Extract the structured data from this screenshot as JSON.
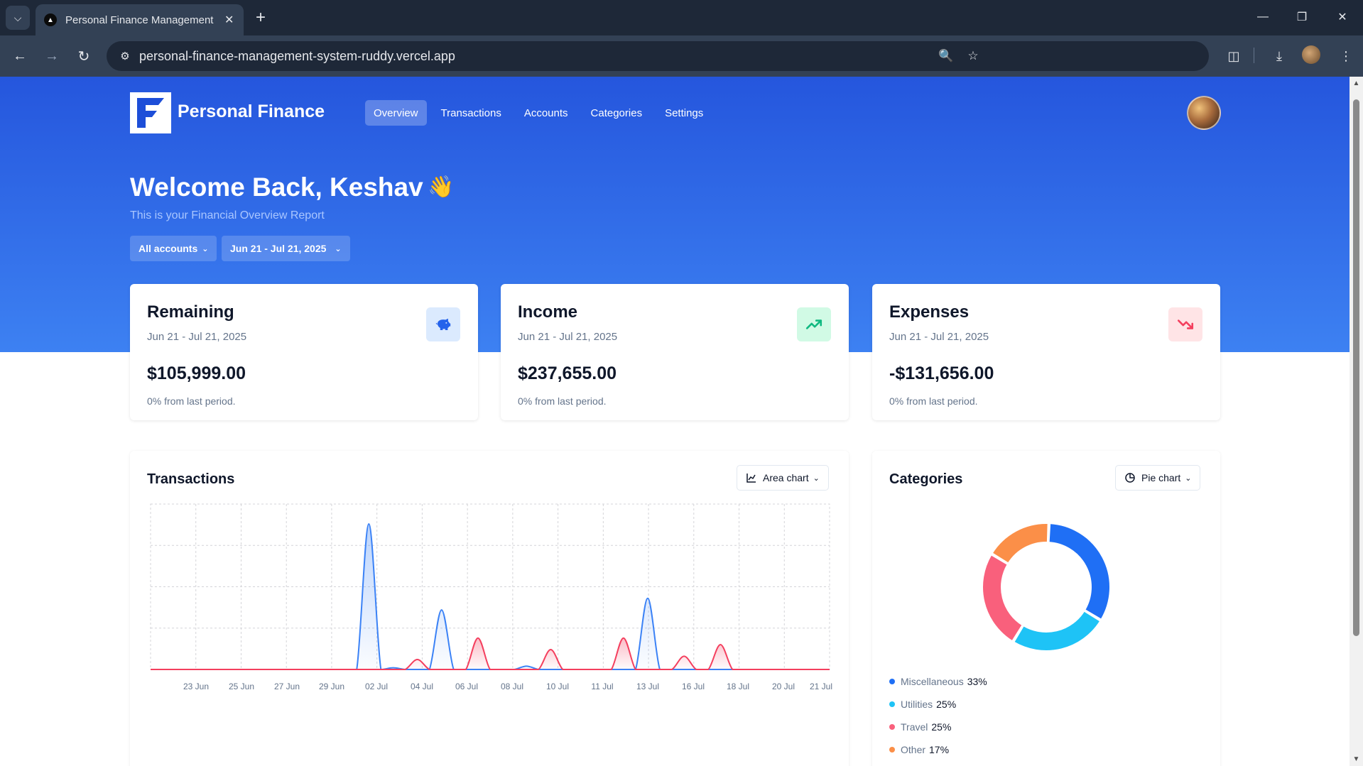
{
  "browser": {
    "tab_title": "Personal Finance Management",
    "url": "personal-finance-management-system-ruddy.vercel.app"
  },
  "header": {
    "brand": "Personal Finance",
    "nav": [
      {
        "label": "Overview",
        "active": true
      },
      {
        "label": "Transactions",
        "active": false
      },
      {
        "label": "Accounts",
        "active": false
      },
      {
        "label": "Categories",
        "active": false
      },
      {
        "label": "Settings",
        "active": false
      }
    ]
  },
  "hero": {
    "welcome": "Welcome Back, Keshav",
    "wave": "👋",
    "subtitle": "This is your Financial Overview Report",
    "account_filter": "All accounts",
    "date_filter": "Jun 21 - Jul 21, 2025"
  },
  "cards": [
    {
      "title": "Remaining",
      "date": "Jun 21 - Jul 21, 2025",
      "value": "$105,999.00",
      "change": "0% from last period.",
      "icon": "piggy-bank-icon",
      "icon_color": "#2563eb",
      "icon_bg": "#dbeafe"
    },
    {
      "title": "Income",
      "date": "Jun 21 - Jul 21, 2025",
      "value": "$237,655.00",
      "change": "0% from last period.",
      "icon": "trending-up-icon",
      "icon_color": "#10b981",
      "icon_bg": "#d1fae5"
    },
    {
      "title": "Expenses",
      "date": "Jun 21 - Jul 21, 2025",
      "value": "-$131,656.00",
      "change": "0% from last period.",
      "icon": "trending-down-icon",
      "icon_color": "#f43f5e",
      "icon_bg": "#ffe4e6"
    }
  ],
  "transactions": {
    "title": "Transactions",
    "chart_selector": "Area chart"
  },
  "categories": {
    "title": "Categories",
    "chart_selector": "Pie chart"
  },
  "chart_data": [
    {
      "type": "area",
      "x_ticks": [
        "23 Jun",
        "25 Jun",
        "27 Jun",
        "29 Jun",
        "02 Jul",
        "04 Jul",
        "06 Jul",
        "08 Jul",
        "10 Jul",
        "11 Jul",
        "13 Jul",
        "16 Jul",
        "18 Jul",
        "20 Jul",
        "21 Jul"
      ],
      "grid": true,
      "series": [
        {
          "color": "#3b82f6",
          "values": [
            0,
            0,
            0,
            0,
            0,
            0,
            0,
            0,
            0,
            0,
            0,
            0,
            0,
            0,
            0,
            0,
            0,
            0,
            0.88,
            0,
            0.01,
            0,
            0,
            0,
            0.36,
            0,
            0,
            0,
            0,
            0,
            0,
            0.02,
            0,
            0,
            0,
            0,
            0,
            0,
            0,
            0,
            0,
            0.43,
            0,
            0,
            0,
            0,
            0,
            0,
            0,
            0,
            0,
            0,
            0,
            0,
            0,
            0,
            0
          ]
        },
        {
          "color": "#f43f5e",
          "values": [
            0,
            0,
            0,
            0,
            0,
            0,
            0,
            0,
            0,
            0,
            0,
            0,
            0,
            0,
            0,
            0,
            0,
            0,
            0,
            0,
            0,
            0,
            0.06,
            0,
            0,
            0,
            0,
            0.19,
            0,
            0,
            0,
            0,
            0,
            0.12,
            0,
            0,
            0,
            0,
            0,
            0.19,
            0,
            0,
            0,
            0,
            0.08,
            0,
            0,
            0.15,
            0,
            0,
            0,
            0,
            0,
            0,
            0,
            0,
            0
          ]
        }
      ]
    },
    {
      "type": "pie",
      "labels": [
        "Miscellaneous",
        "Utilities",
        "Travel",
        "Other"
      ],
      "values": [
        33,
        25,
        25,
        17
      ],
      "value_labels": [
        "33%",
        "25%",
        "25%",
        "17%"
      ],
      "colors": [
        "#1f6ff5",
        "#1ec3f6",
        "#f9607c",
        "#fb8f48"
      ]
    }
  ]
}
